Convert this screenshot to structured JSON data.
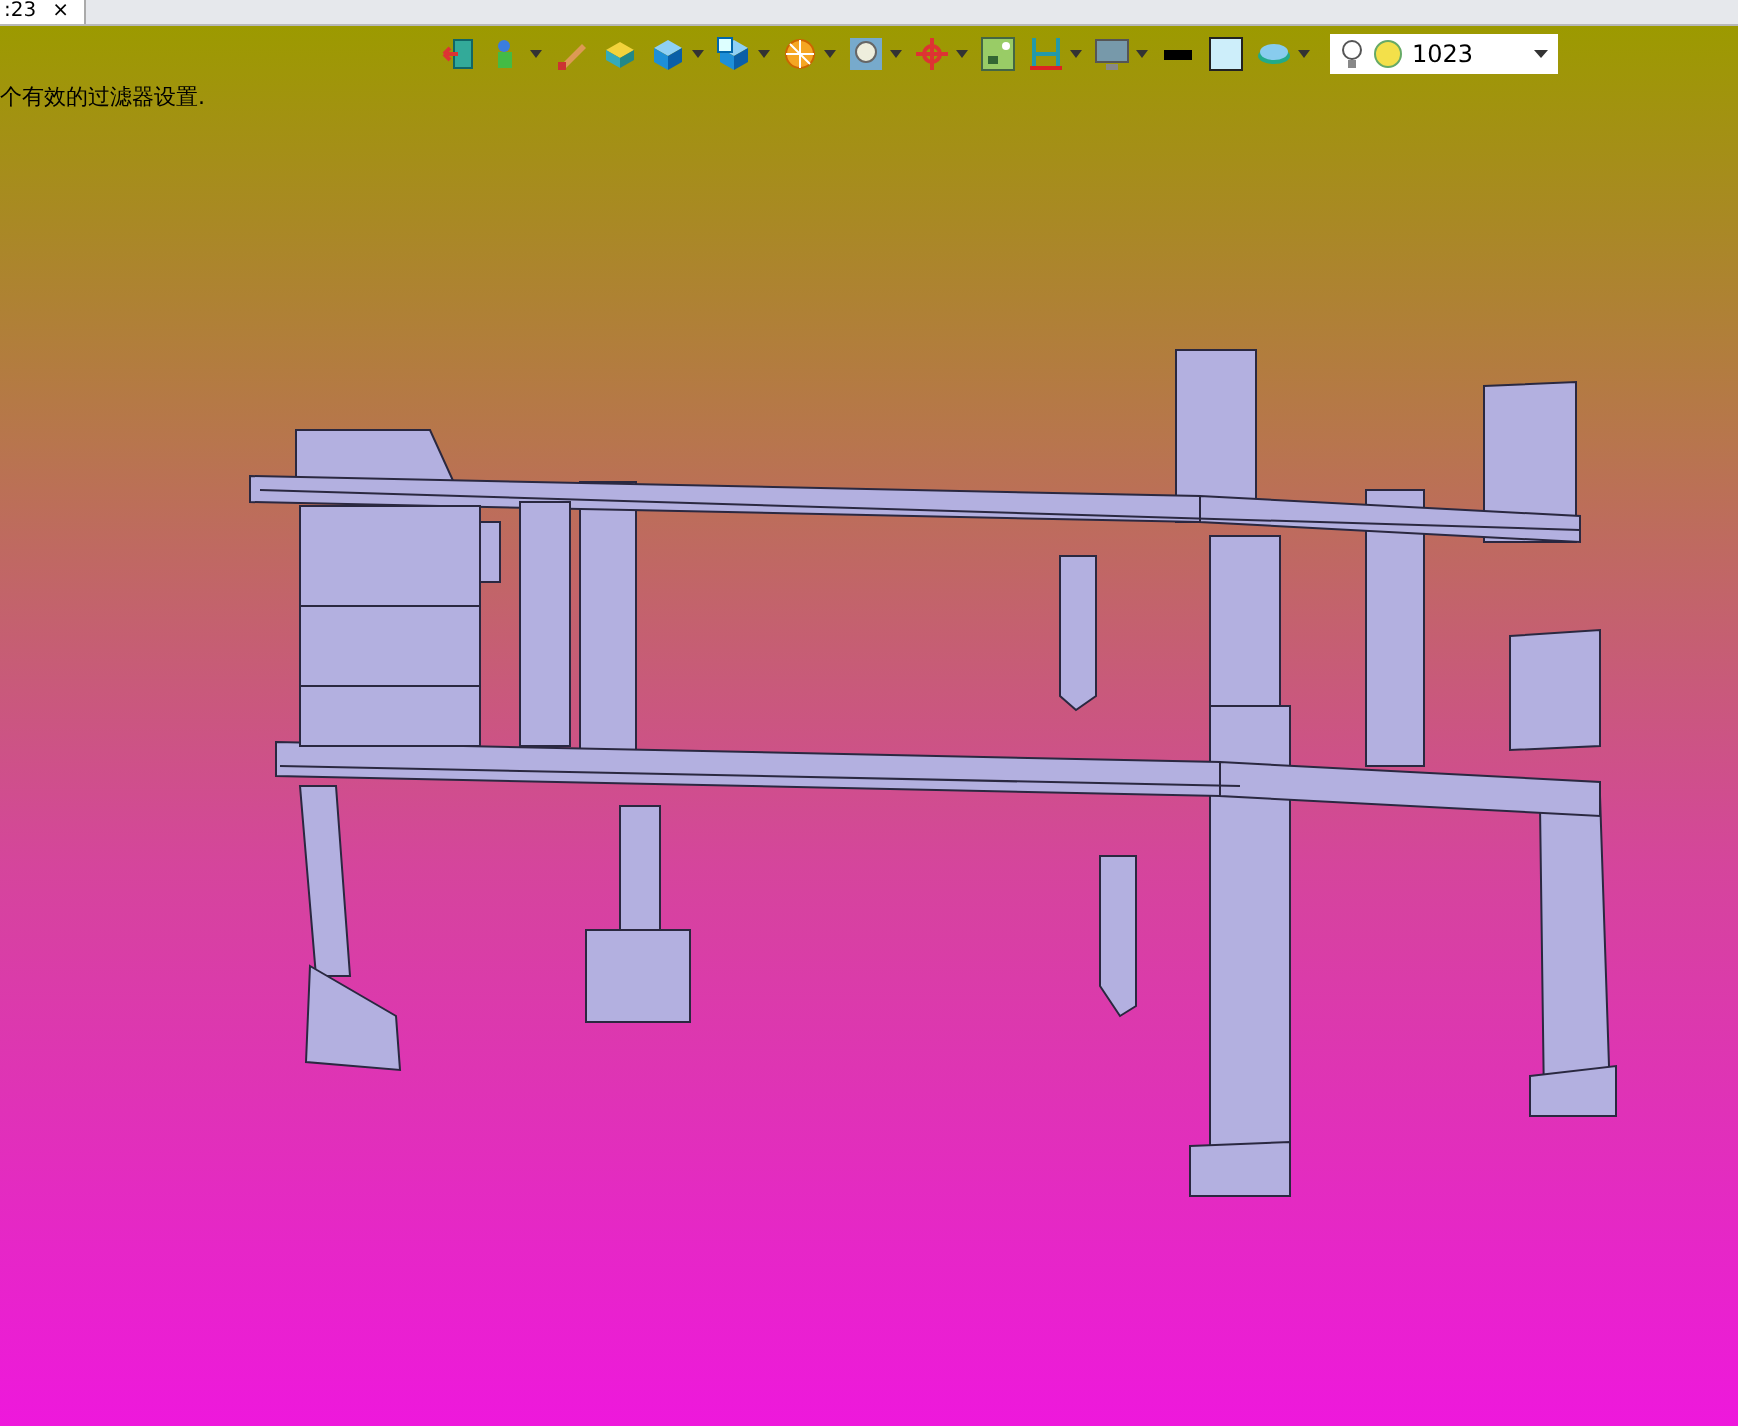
{
  "tab": {
    "label": ":23",
    "close": "×"
  },
  "toolbar": {
    "layer_value": "1023"
  },
  "status_message": "个有效的过滤器设置."
}
